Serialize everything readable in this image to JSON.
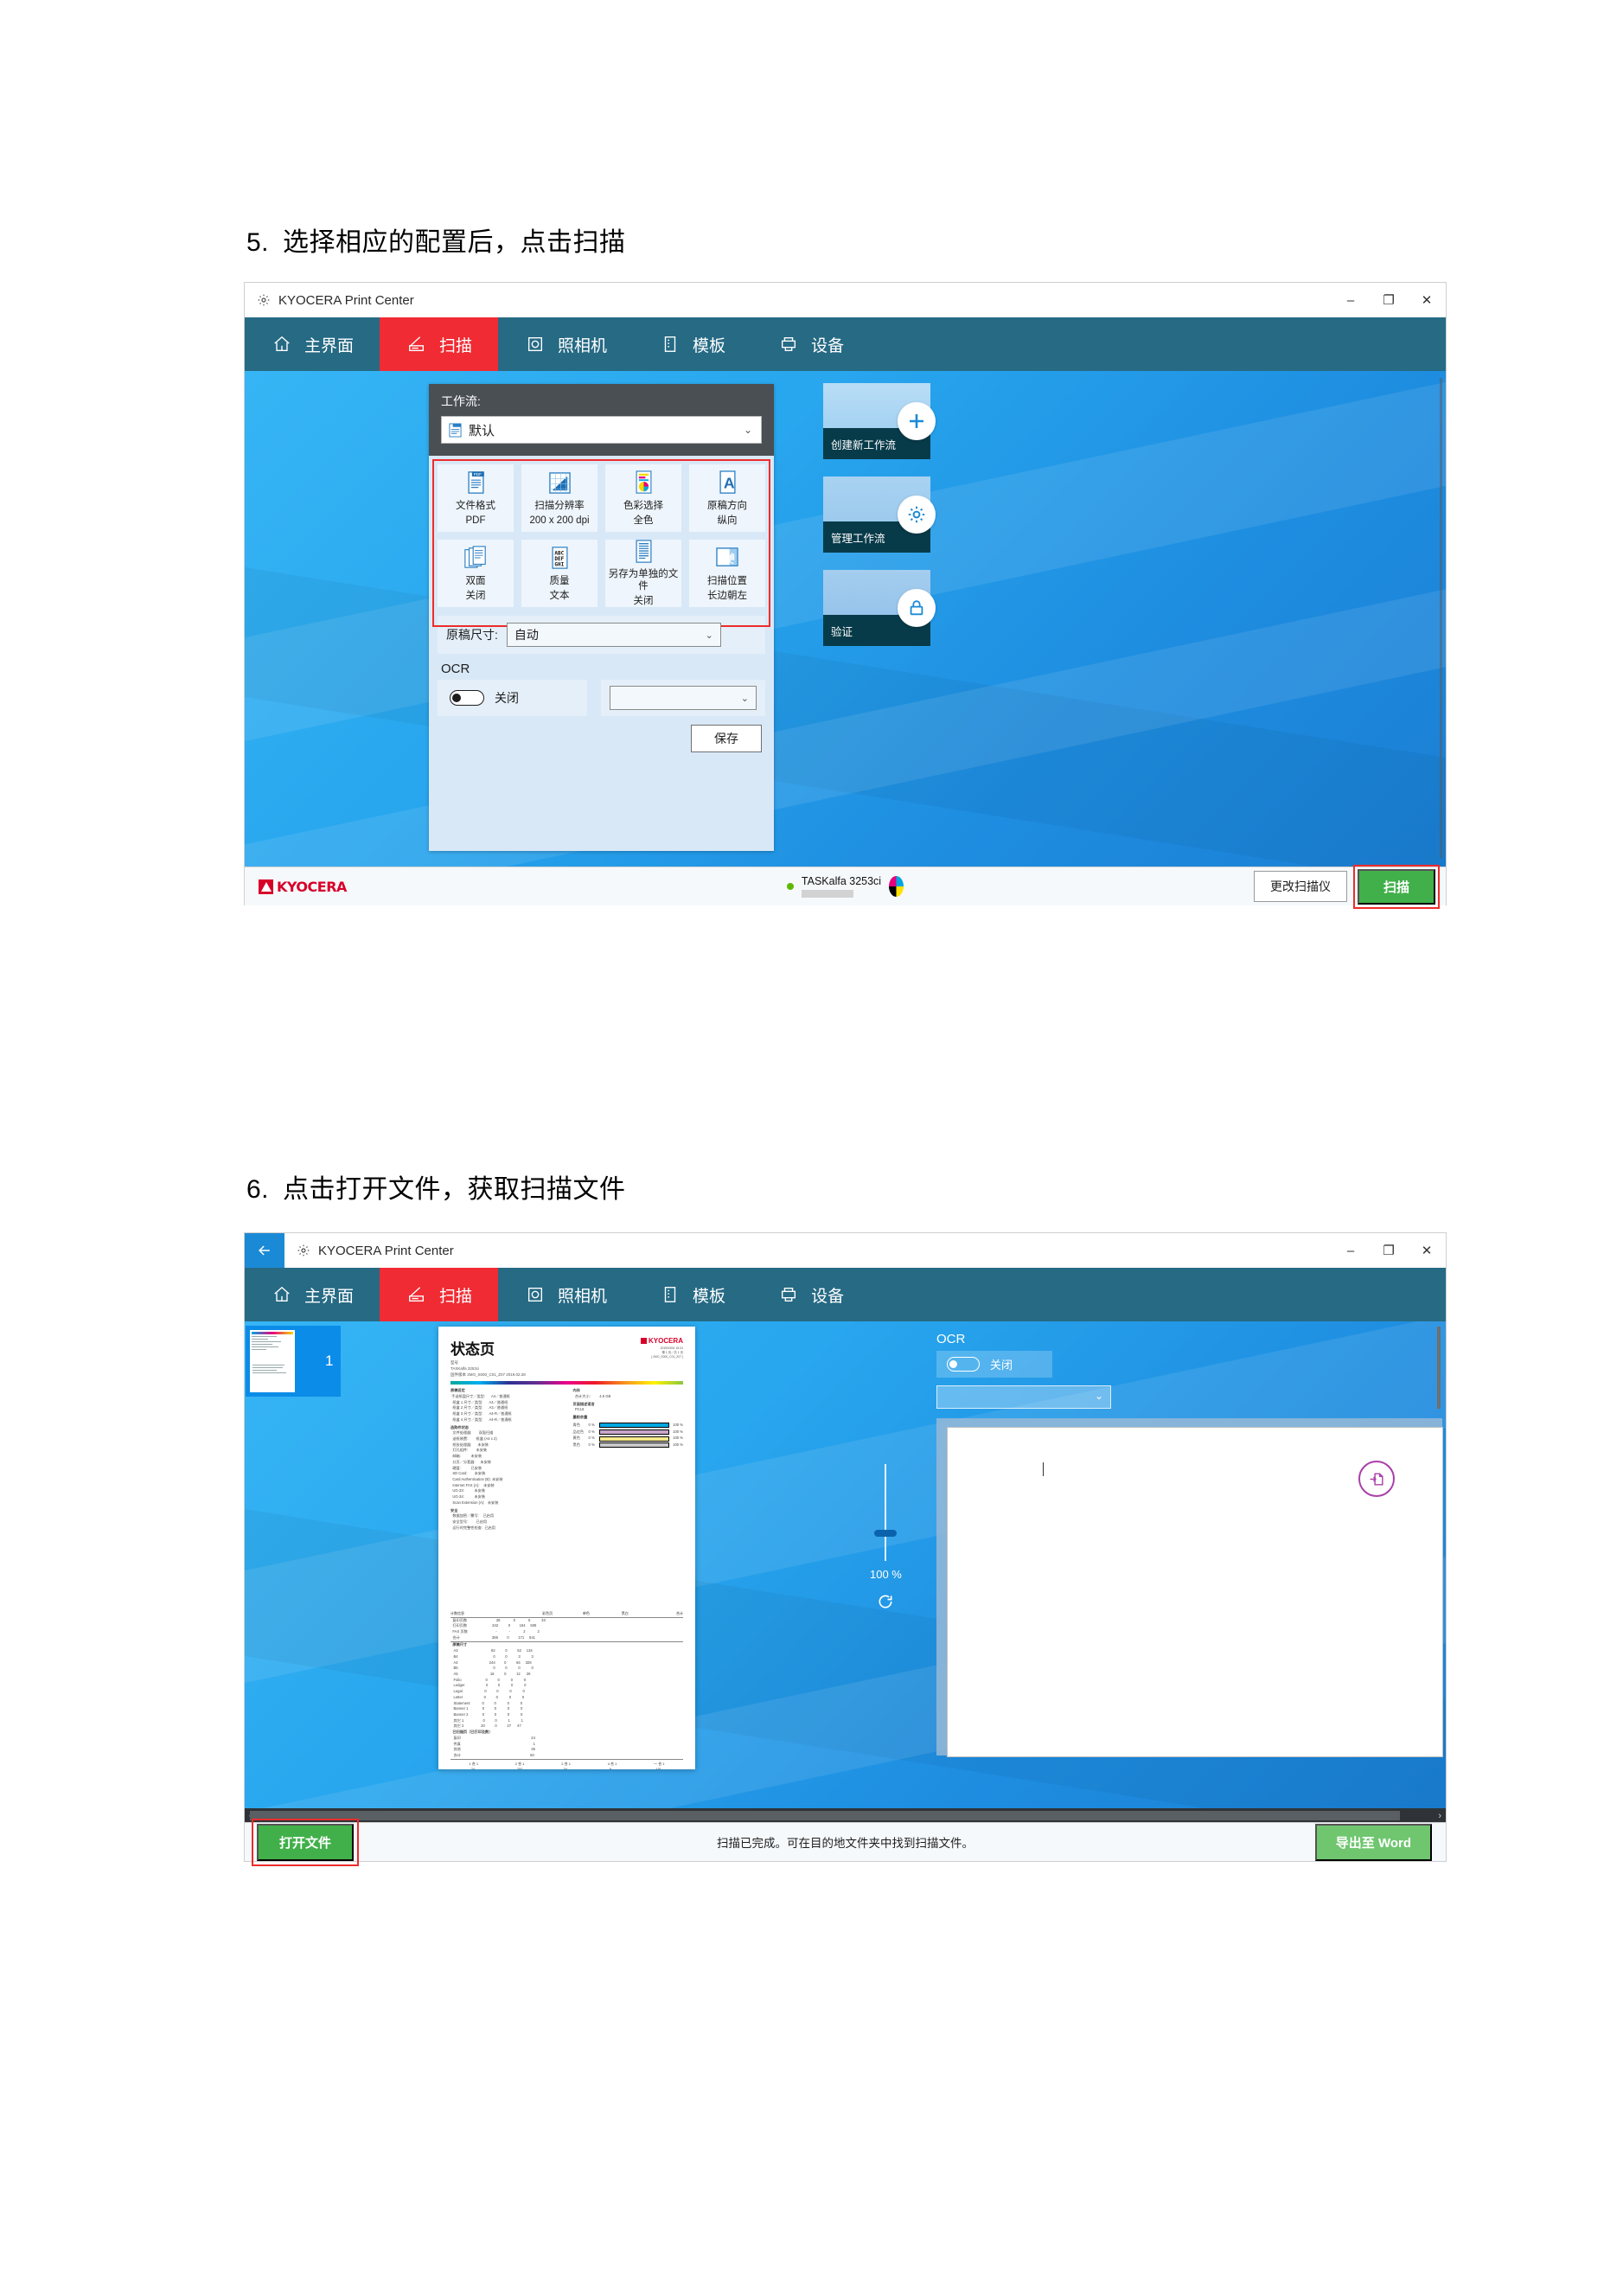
{
  "doc": {
    "steps": [
      {
        "num": "5.",
        "text": "选择相应的配置后，点击扫描"
      },
      {
        "num": "6.",
        "text": "点击打开文件，获取扫描文件"
      }
    ]
  },
  "colors": {
    "nav_bg": "#266a84",
    "nav_active": "#f02b33",
    "accent_green": "#41b04a",
    "kyocera_red": "#d8002a",
    "highlight_red": "#ee2b2b",
    "tile_dark": "#083b4a",
    "workflow_header": "#4a4f54"
  },
  "window1": {
    "title": "KYOCERA Print Center",
    "title_icon": "gear-icon",
    "controls": {
      "minimize": "–",
      "maximize": "❐",
      "close": "✕"
    },
    "tabs": [
      {
        "label": "主界面",
        "icon": "home-icon",
        "active": false
      },
      {
        "label": "扫描",
        "icon": "scanner-icon",
        "active": true
      },
      {
        "label": "照相机",
        "icon": "camera-icon",
        "active": false
      },
      {
        "label": "模板",
        "icon": "template-icon",
        "active": false
      },
      {
        "label": "设备",
        "icon": "device-icon",
        "active": false
      }
    ],
    "workflow": {
      "label": "工作流:",
      "selected": "默认",
      "select_icon": "document-pdf-icon",
      "chevron": "⌄"
    },
    "tiles": [
      {
        "icon": "file-format-icon",
        "line1": "文件格式",
        "line2": "PDF"
      },
      {
        "icon": "resolution-icon",
        "line1": "扫描分辨率",
        "line2": "200 x 200 dpi"
      },
      {
        "icon": "color-select-icon",
        "line1": "色彩选择",
        "line2": "全色"
      },
      {
        "icon": "orientation-icon",
        "line1": "原稿方向",
        "line2": "纵向"
      },
      {
        "icon": "duplex-icon",
        "line1": "双面",
        "line2": "关闭"
      },
      {
        "icon": "quality-icon",
        "line1": "质量",
        "line2": "文本"
      },
      {
        "icon": "separate-file-icon",
        "line1": "另存为单独的文件",
        "line2": "关闭"
      },
      {
        "icon": "scan-position-icon",
        "line1": "扫描位置",
        "line2": "长边朝左"
      }
    ],
    "original_size": {
      "label": "原稿尺寸:",
      "value": "自动",
      "chevron": "⌄"
    },
    "ocr": {
      "label": "OCR",
      "toggle_state": "关闭",
      "language_value": "",
      "chevron": "⌄"
    },
    "save_label": "保存",
    "action_tiles": [
      {
        "label": "创建新工作流",
        "icon": "plus-icon"
      },
      {
        "label": "管理工作流",
        "icon": "gear-icon"
      },
      {
        "label": "验证",
        "icon": "lock-icon"
      }
    ],
    "footer": {
      "brand": "KYOCERA",
      "device_name": "TASKalfa 3253ci",
      "device_status_icon": "green-dot-icon",
      "toner_icon": "toner-pie-icon",
      "change_scanner_label": "更改扫描仪",
      "scan_label": "扫描"
    }
  },
  "window2": {
    "title": "KYOCERA Print Center",
    "back_icon": "back-arrow-icon",
    "title_icon": "gear-icon",
    "controls": {
      "minimize": "–",
      "maximize": "❐",
      "close": "✕"
    },
    "tabs": [
      {
        "label": "主界面",
        "icon": "home-icon",
        "active": false
      },
      {
        "label": "扫描",
        "icon": "scanner-icon",
        "active": true
      },
      {
        "label": "照相机",
        "icon": "camera-icon",
        "active": false
      },
      {
        "label": "模板",
        "icon": "template-icon",
        "active": false
      },
      {
        "label": "设备",
        "icon": "device-icon",
        "active": false
      }
    ],
    "thumbnail": {
      "page_number": "1"
    },
    "preview": {
      "doc_title": "状态页",
      "doc_brand": "KYOCERA",
      "model_line": "TASKalfa 3253ci",
      "firmware_line": "固件版本  2MO_S000_C01_Z07 2019.02.28"
    },
    "zoom": {
      "percent": "100 %",
      "rotate_icon": "rotate-icon"
    },
    "ocr": {
      "label": "OCR",
      "toggle_state": "关闭",
      "language_value": "",
      "chevron": "⌄"
    },
    "ocr_result": {
      "import_icon": "import-document-icon"
    },
    "footer": {
      "open_file_label": "打开文件",
      "status_text": "扫描已完成。可在目的地文件夹中找到扫描文件。",
      "export_label": "导出至 Word"
    }
  }
}
